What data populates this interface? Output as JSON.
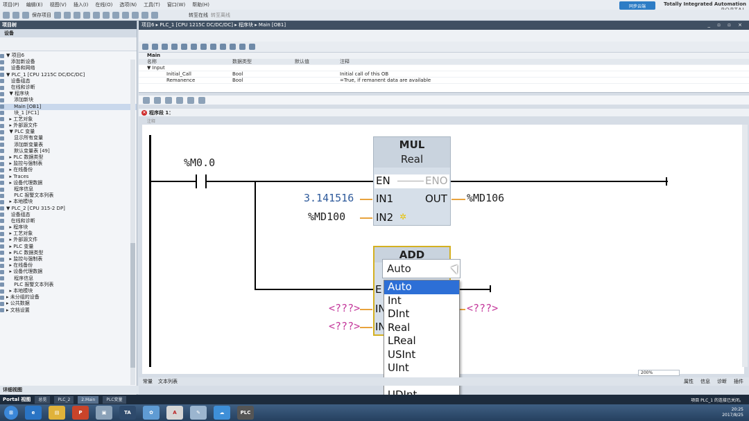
{
  "menu": [
    "项目(P)",
    "编辑(E)",
    "视图(V)",
    "插入(I)",
    "在线(O)",
    "选项(N)",
    "工具(T)",
    "窗口(W)",
    "帮助(H)"
  ],
  "toolbar": {
    "save_label": "保存项目",
    "go_online": "转至在线",
    "go_offline": "转至离线"
  },
  "brand": {
    "title": "Totally Integrated Automation",
    "portal": "PORTAL",
    "cloud": "同步云端"
  },
  "left_panel": {
    "title": "项目树",
    "subtitle": "设备",
    "items": [
      "▼ 项目6",
      "   添加新设备",
      "   设备和网络",
      "▼ PLC_1 [CPU 1215C DC/DC/DC]",
      "   设备组态",
      "   在线和诊断",
      "  ▼ 程序块",
      "     添加新块",
      "     Main [OB1]",
      "     块_1 [FC1]",
      "  ▸ 工艺对象",
      "  ▸ 外部源文件",
      "  ▼ PLC 变量",
      "     显示所有变量",
      "     添加新变量表",
      "     默认变量表 [49]",
      "  ▸ PLC 数据类型",
      "  ▸ 监控与强制表",
      "  ▸ 在线备份",
      "  ▸ Traces",
      "  ▸ 设备代理数据",
      "     程序信息",
      "     PLC 报警文本列表",
      "  ▸ 本地模块",
      "▼ PLC_2 [CPU 315-2 DP]",
      "   设备组态",
      "   在线和诊断",
      "  ▸ 程序块",
      "  ▸ 工艺对象",
      "  ▸ 外部源文件",
      "  ▸ PLC 变量",
      "  ▸ PLC 数据类型",
      "  ▸ 监控与强制表",
      "  ▸ 在线备份",
      "  ▸ 设备代理数据",
      "     程序信息",
      "     PLC 报警文本列表",
      "  ▸ 本地模块",
      "▸ 未分组的设备",
      "▸ 公共数据",
      "▸ 文档设置"
    ],
    "status": "详细视图"
  },
  "editor": {
    "breadcrumb": "项目6 ▸ PLC_1 [CPU 1215C DC/DC/DC] ▸ 程序块 ▸ Main [OB1]",
    "win_controls": "_ ▫ ▫ ×",
    "block_name": "Main",
    "iface_headers": [
      "名称",
      "数据类型",
      "默认值",
      "注释"
    ],
    "iface_rows": [
      [
        "▼ Input",
        "",
        "",
        ""
      ],
      [
        "Initial_Call",
        "Bool",
        "",
        "Initial call of this OB"
      ],
      [
        "Remanence",
        "Bool",
        "",
        "=True, if remanent data are available"
      ]
    ],
    "network_title": "程序段 1：",
    "network_comment": "注释",
    "zoom": "200%"
  },
  "ladder": {
    "contact_tag": "%M0.0",
    "mul": {
      "name": "MUL",
      "type": "Real",
      "en": "EN",
      "eno": "ENO",
      "in1": "IN1",
      "in2": "IN2",
      "out": "OUT",
      "in1_val": "3.141516",
      "in2_val": "%MD100",
      "out_val": "%MD106"
    },
    "add": {
      "name": "ADD",
      "en": "E",
      "in1": "IN",
      "in2": "IN",
      "in1_val": "<???>",
      "in2_val": "<???>",
      "out_val": "<???>"
    }
  },
  "dropdown": {
    "current": "Auto",
    "options": [
      "Auto",
      "Int",
      "DInt",
      "Real",
      "LReal",
      "USInt",
      "UInt",
      "SInt",
      "UDInt"
    ],
    "selected_index": 0
  },
  "bottom_tabs": {
    "left": [
      "常量",
      "文本列表"
    ],
    "right": [
      "属性",
      "信息",
      "诊断",
      "插件"
    ]
  },
  "portal_bar": {
    "portal_view": "Portal 视图",
    "tabs": [
      "总览",
      "PLC_2",
      "2.Main",
      "PLC变量"
    ],
    "message": "项目 PLC_1 的连接已关闭。"
  },
  "taskbar": {
    "time": "20:25",
    "date": "2017/8/25"
  }
}
